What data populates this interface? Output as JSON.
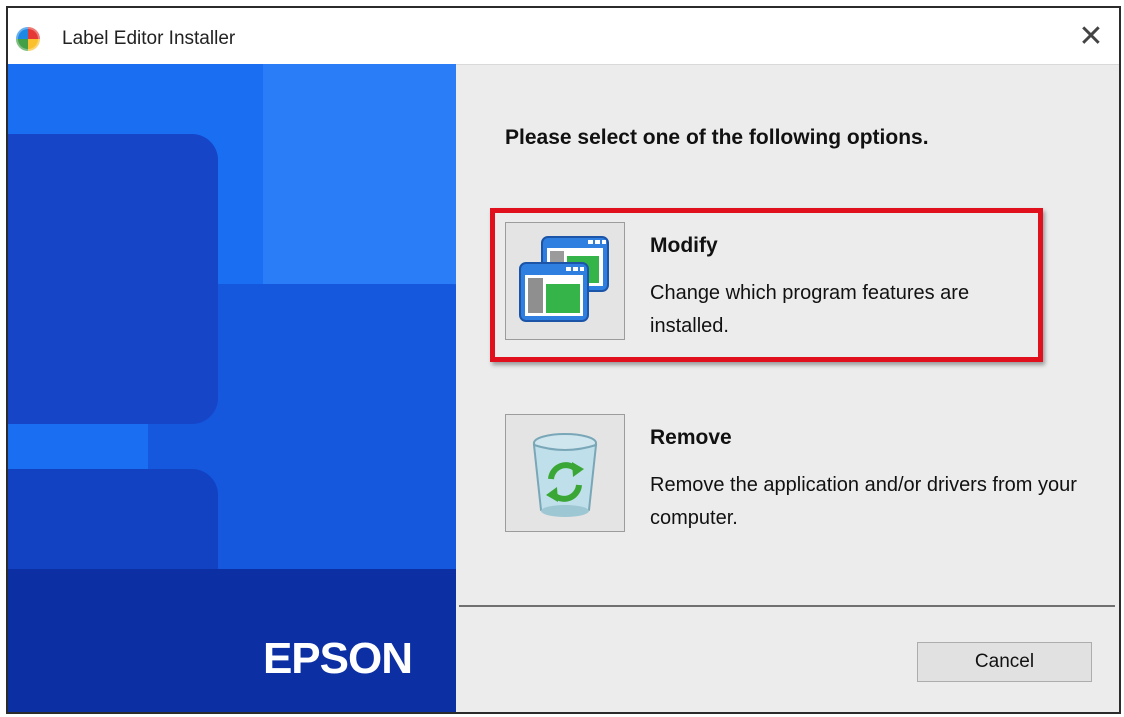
{
  "window": {
    "title": "Label Editor Installer",
    "close_glyph": "✕"
  },
  "banner": {
    "brand": "EPSON"
  },
  "main": {
    "prompt": "Please select one of the following options.",
    "options": [
      {
        "title": "Modify",
        "description": "Change which program features are installed.",
        "icon": "program-windows-icon"
      },
      {
        "title": "Remove",
        "description": "Remove the application and/or drivers from your computer.",
        "icon": "recycle-bin-icon"
      }
    ],
    "highlight_color": "#e0101c"
  },
  "footer": {
    "cancel_label": "Cancel"
  }
}
